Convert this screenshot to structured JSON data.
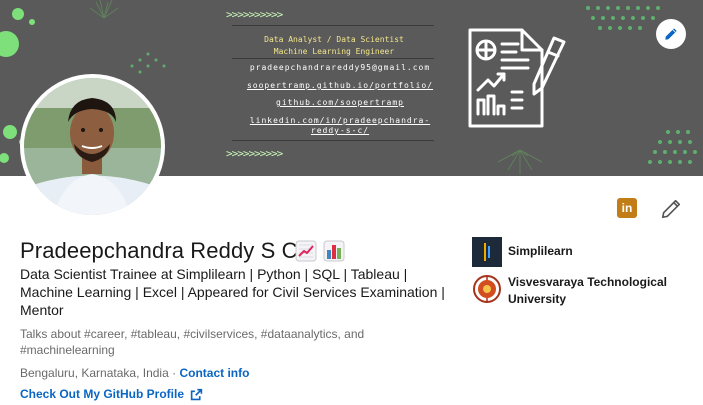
{
  "banner": {
    "role_line1": "Data Analyst / Data Scientist",
    "role_line2": "Machine Learning Engineer",
    "email": "pradeepchandrareddy95@gmail.com",
    "portfolio": "soopertramp.github.io/portfolio/",
    "github": "github.com/soopertramp",
    "linkedin_line1": "linkedin.com/in/pradeepchandra-",
    "linkedin_line2": "reddy-s-c/",
    "chevrons": ">>>>>>>>>>",
    "icons": {
      "edit": "pencil-icon",
      "document": "report-document-icon"
    },
    "colors": {
      "background": "#5a5a5a",
      "accent_green": "#6fdc68",
      "role_text": "#f3e58a"
    }
  },
  "profile": {
    "name": "Pradeepchandra Reddy S C",
    "name_emojis": [
      "chart-increasing-icon",
      "bar-chart-icon"
    ],
    "headline": "Data Scientist Trainee at Simplilearn | Python | SQL | Tableau | Machine Learning | Excel | Appeared for Civil Services Examination | Mentor",
    "talks_about": "Talks about #career, #tableau, #civilservices, #dataanalytics, and #machinelearning",
    "location": "Bengaluru, Karnataka, India",
    "location_sep": " · ",
    "contact_info": "Contact info",
    "github_link": "Check Out My GitHub Profile",
    "link_color": "#0a66c2"
  },
  "actions": {
    "linkedin_badge": "in",
    "icons": {
      "linkedin": "linkedin-logo-icon",
      "edit": "pencil-icon",
      "external": "external-link-icon"
    }
  },
  "sidebar": {
    "organizations": [
      {
        "name": "Simplilearn",
        "icon": "simplilearn-logo-icon"
      },
      {
        "name": "Visvesvaraya Technological University",
        "icon": "vtu-logo-icon"
      }
    ]
  }
}
